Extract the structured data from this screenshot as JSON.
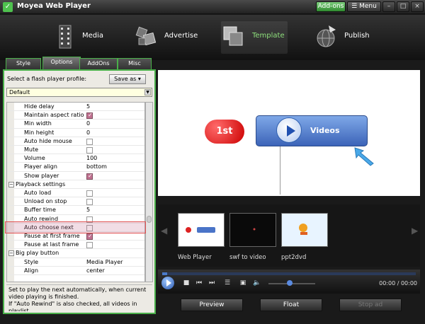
{
  "window": {
    "title": "Moyea Web Player",
    "addons_button": "Add-ons",
    "menu_button": "Menu"
  },
  "nav": [
    {
      "label": "Media",
      "icon": "film-strip-icon",
      "active": false
    },
    {
      "label": "Advertise",
      "icon": "advertise-cubes-icon",
      "active": false
    },
    {
      "label": "Template",
      "icon": "template-icon",
      "active": true
    },
    {
      "label": "Publish",
      "icon": "publish-globe-icon",
      "active": false
    }
  ],
  "tabs": [
    {
      "label": "Style",
      "active": false
    },
    {
      "label": "Options",
      "active": true
    },
    {
      "label": "AddOns",
      "active": false
    },
    {
      "label": "Misc",
      "active": false
    }
  ],
  "profile": {
    "label": "Select a flash player profile:",
    "save_as": "Save as",
    "selected": "Default"
  },
  "properties": [
    {
      "name": "Hide delay",
      "value": "5"
    },
    {
      "name": "Maintain aspect ratio",
      "checked": true
    },
    {
      "name": "Min width",
      "value": "0"
    },
    {
      "name": "Min height",
      "value": "0"
    },
    {
      "name": "Auto hide mouse",
      "checked": false
    },
    {
      "name": "Mute",
      "checked": false
    },
    {
      "name": "Volume",
      "value": "100"
    },
    {
      "name": "Player align",
      "value": "bottom"
    },
    {
      "name": "Show player",
      "checked": true
    },
    {
      "name": "Playback settings",
      "category": true,
      "expanded": false
    },
    {
      "name": "Auto load",
      "checked": false
    },
    {
      "name": "Unload on stop",
      "checked": false
    },
    {
      "name": "Buffer time",
      "value": "5"
    },
    {
      "name": "Auto rewind",
      "checked": false
    },
    {
      "name": "Auto choose next",
      "checked": false,
      "highlighted": true
    },
    {
      "name": "Pause at first frame",
      "checked": true
    },
    {
      "name": "Pause at last frame",
      "checked": false
    },
    {
      "name": "Big play button",
      "category": true,
      "expanded": false
    },
    {
      "name": "Style",
      "value": "Media Player"
    },
    {
      "name": "Align",
      "value": "center"
    }
  ],
  "description": "Set to play the next automatically, when current video playing is finished.\nIf \"Auto Rewind\" is also checked, all videos in playlist",
  "preview": {
    "badge": "1st",
    "video_label": "Videos"
  },
  "thumbnails": [
    {
      "label": "Web Player"
    },
    {
      "label": "swf to video"
    },
    {
      "label": "ppt2dvd"
    }
  ],
  "player": {
    "time": "00:00 / 00:00",
    "progress": 0.02,
    "volume": 0.45
  },
  "buttons": {
    "preview": "Preview",
    "float": "Float",
    "stop_ad": "Stop ad"
  },
  "colors": {
    "accent_green": "#4ab04a",
    "highlight_red": "#e05050"
  }
}
